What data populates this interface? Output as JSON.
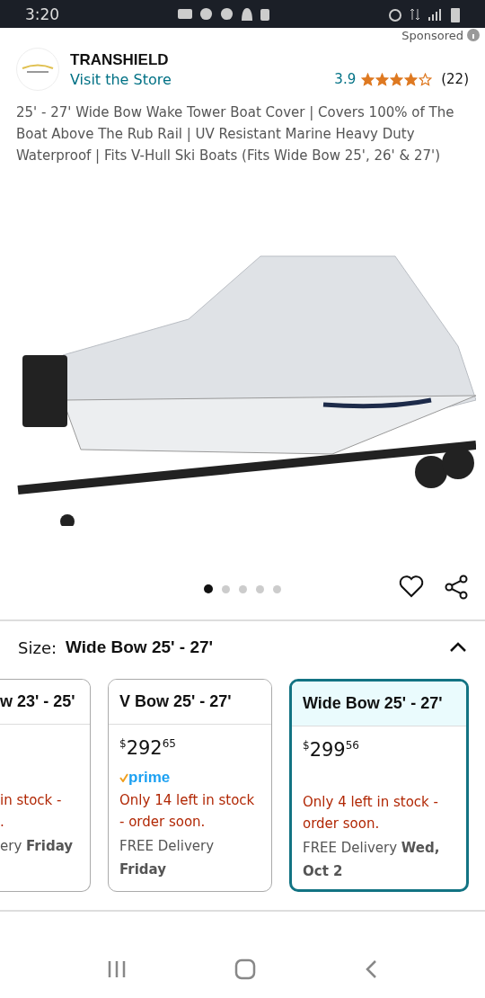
{
  "status_bar": {
    "time": "3:20"
  },
  "sponsored": "Sponsored",
  "brand": {
    "name": "TRANSHIELD",
    "store_link": "Visit the Store",
    "rating": "3.9",
    "stars": 4,
    "review_count": "(22)"
  },
  "title": "25' - 27' Wide Bow Wake Tower Boat Cover | Covers 100% of The Boat Above The Rub Rail | UV Resistant Marine Heavy Duty Waterproof | Fits V-Hull Ski Boats (Fits Wide Bow 25', 26' & 27')",
  "image_dots": [
    {
      "selected": true
    },
    {
      "selected": false
    },
    {
      "selected": false
    },
    {
      "selected": false
    },
    {
      "selected": false
    }
  ],
  "size": {
    "label": "Size:",
    "value": "Wide Bow 25' - 27'",
    "expanded": true
  },
  "options": [
    {
      "kind": "partial",
      "selected": false,
      "title": "w 23' - 25'",
      "stock": [
        "in stock -",
        "."
      ],
      "delivery": "ery",
      "delivery_day": "Friday"
    },
    {
      "kind": "full",
      "selected": false,
      "title": "V Bow 25' - 27'",
      "dollars": "292",
      "cents": "65",
      "currency": "$",
      "prime": "prime",
      "stock": [
        "Only 14 left in stock - order soon."
      ],
      "delivery": "FREE Delivery",
      "delivery_day": "Friday"
    },
    {
      "kind": "full",
      "selected": true,
      "title": "Wide Bow 25' - 27'",
      "dollars": "299",
      "cents": "56",
      "currency": "$",
      "stock": [
        "Only 4 left in stock - order soon."
      ],
      "delivery": "FREE Delivery",
      "delivery_day": "Wed, Oct 2"
    }
  ]
}
